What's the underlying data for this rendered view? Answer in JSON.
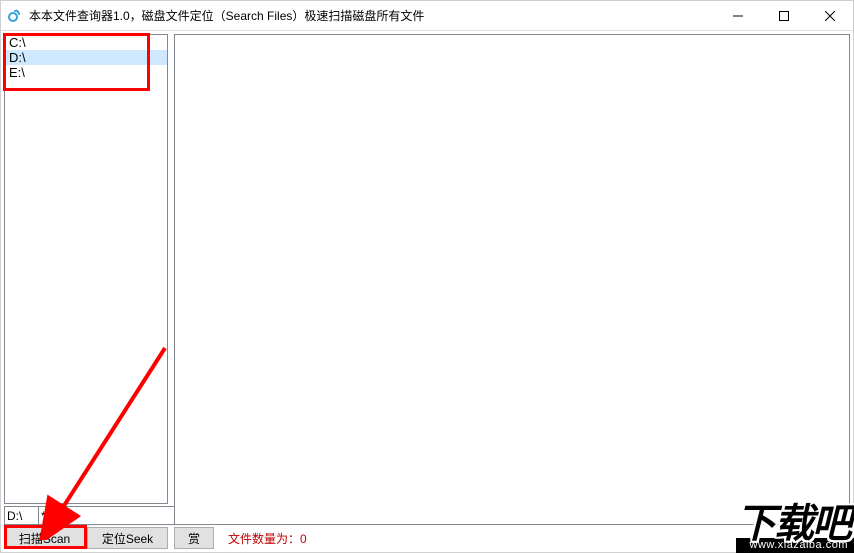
{
  "titlebar": {
    "title": "本本文件查询器1.0，磁盘文件定位（Search Files）极速扫描磁盘所有文件"
  },
  "drives": {
    "items": [
      {
        "label": "C:\\",
        "selected": false
      },
      {
        "label": "D:\\",
        "selected": true
      },
      {
        "label": "E:\\",
        "selected": false
      }
    ]
  },
  "inputs": {
    "path_value": "D:\\",
    "filter_value": "*.*"
  },
  "buttons": {
    "scan": "扫描Scan",
    "seek": "定位Seek",
    "reward": "赏"
  },
  "status": {
    "file_count_text": "文件数量为：0"
  },
  "watermark": {
    "main": "下载吧",
    "url": "www.xiazaiba.com"
  }
}
